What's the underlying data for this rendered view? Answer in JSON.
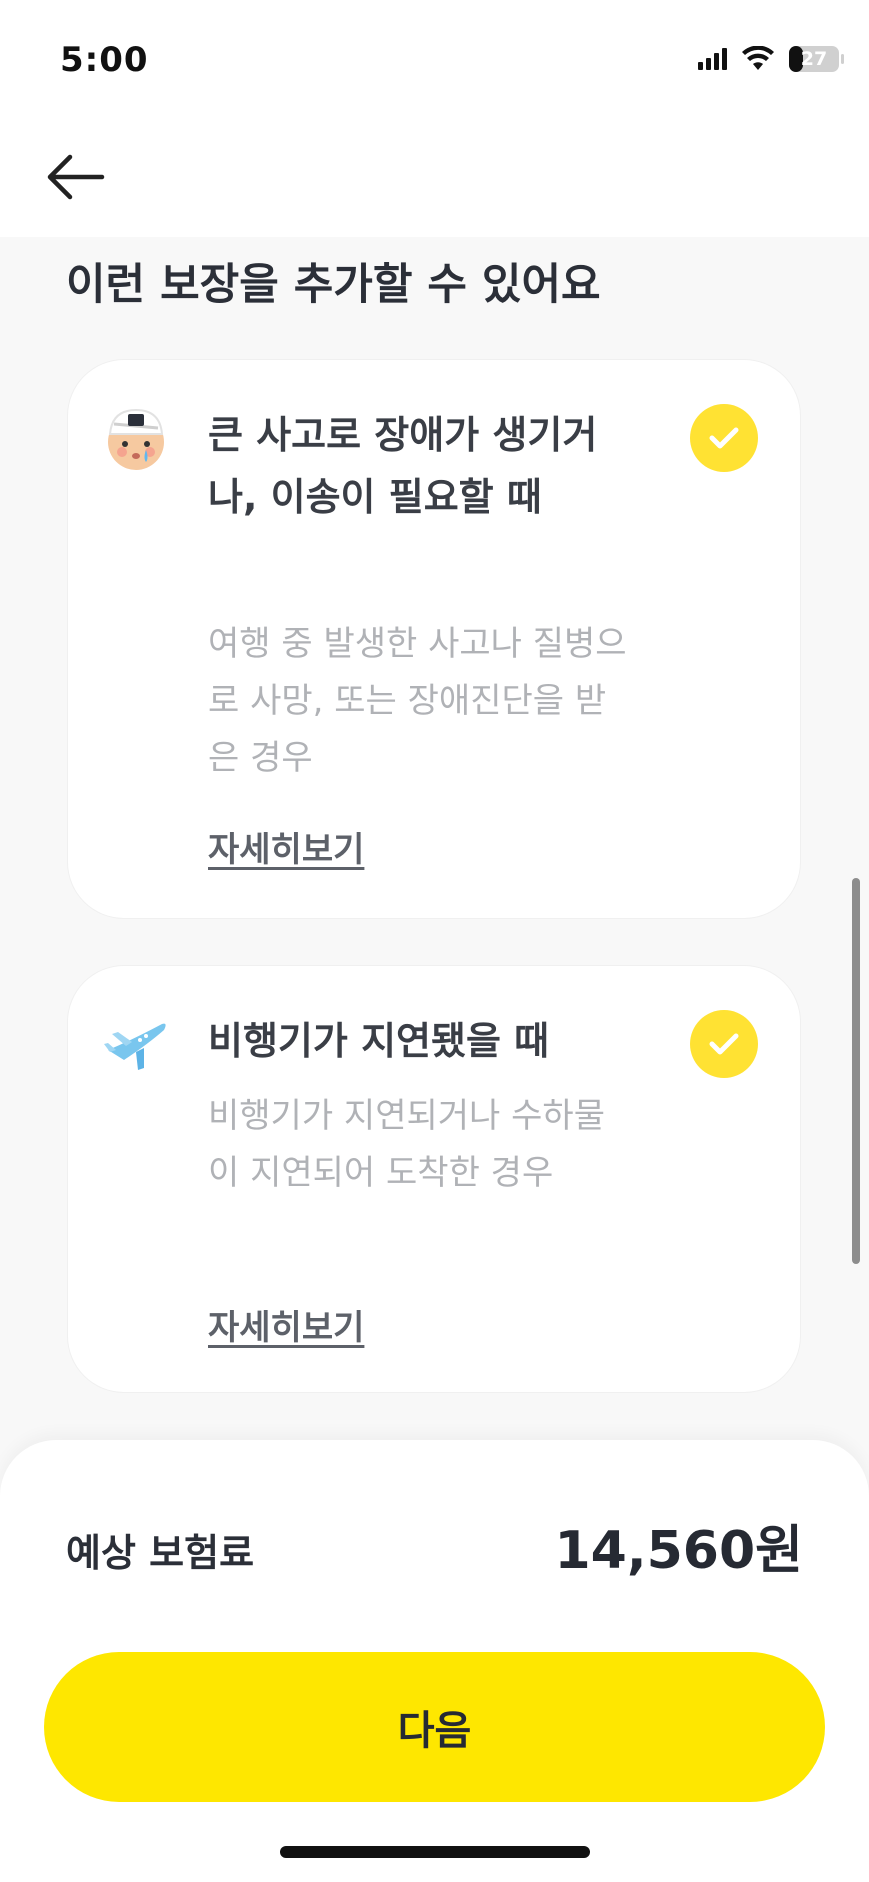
{
  "status_bar": {
    "time": "5:00",
    "battery": "27",
    "icons": [
      "signal-icon",
      "wifi-icon",
      "battery-icon"
    ]
  },
  "header": {
    "back_icon": "arrow-left-icon"
  },
  "section_title": "이런 보장을 추가할 수 있어요",
  "coverages": [
    {
      "icon": "injured-face-icon",
      "title": "큰 사고로 장애가 생기거나, 이송이 필요할 때",
      "description": "여행 중 발생한 사고나 질병으로 사망, 또는 장애진단을 받은 경우",
      "detail_label": "자세히보기",
      "checked": true
    },
    {
      "icon": "airplane-icon",
      "title": "비행기가 지연됐을 때",
      "description": "비행기가 지연되거나 수하물이 지연되어 도착한 경우",
      "detail_label": "자세히보기",
      "checked": true
    }
  ],
  "footer": {
    "premium_label": "예상 보험료",
    "premium_amount": "14,560원",
    "next_label": "다음"
  },
  "colors": {
    "accent_yellow": "#fee700",
    "check_yellow": "#ffe233",
    "background": "#f8f8f8",
    "text_dark": "#2b2f38",
    "text_muted": "#b0b2b6"
  }
}
